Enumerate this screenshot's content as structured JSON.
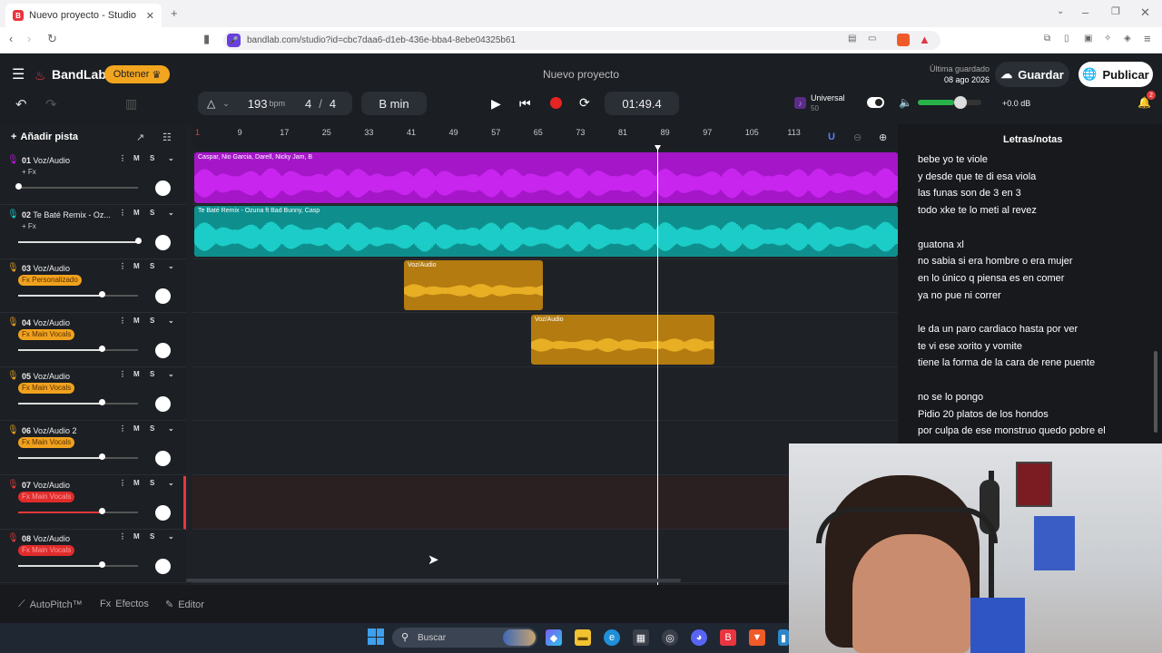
{
  "browser": {
    "tab_title": "Nuevo proyecto - Studio",
    "url": "bandlab.com/studio?id=cbc7daa6-d1eb-436e-bba4-8ebe04325b61"
  },
  "header": {
    "brand": "BandLab",
    "get_button": "Obtener",
    "project_title": "Nuevo proyecto",
    "last_saved_label": "Última guardado",
    "last_saved_date": "08 ago 2026",
    "save_button": "Guardar",
    "publish_button": "Publicar",
    "notification_count": "2"
  },
  "transport": {
    "tempo": "193",
    "tempo_unit": "bpm",
    "time_sig_num": "4",
    "time_sig_den": "4",
    "key": "B min",
    "time": "01:49.4",
    "preset_name": "Universal",
    "preset_sub": "50",
    "master_db": "+0.0 dB"
  },
  "tracks_panel": {
    "add_track": "Añadir pista"
  },
  "tracks": [
    {
      "num": "01",
      "name": "Voz/Audio",
      "fx": "+ Fx",
      "fx_style": "plain",
      "color": "#c216e6",
      "vol": 0.0
    },
    {
      "num": "02",
      "name": "Te Baté Remix - Oz...",
      "fx": "+ Fx",
      "fx_style": "plain",
      "color": "#19c9c5",
      "vol": 1.0
    },
    {
      "num": "03",
      "name": "Voz/Audio",
      "fx": "Fx Personalizado",
      "fx_style": "orange",
      "color": "#e7a21c",
      "vol": 0.7
    },
    {
      "num": "04",
      "name": "Voz/Audio",
      "fx": "Fx Main Vocals",
      "fx_style": "orange",
      "color": "#e7a21c",
      "vol": 0.7
    },
    {
      "num": "05",
      "name": "Voz/Audio",
      "fx": "Fx Main Vocals",
      "fx_style": "orange",
      "color": "#e7a21c",
      "vol": 0.7
    },
    {
      "num": "06",
      "name": "Voz/Audio 2",
      "fx": "Fx Main Vocals",
      "fx_style": "orange",
      "color": "#e7a21c",
      "vol": 0.7
    },
    {
      "num": "07",
      "name": "Voz/Audio",
      "fx": "Fx Main Vocals",
      "fx_style": "red",
      "color": "#e23a3a",
      "vol": 0.7
    },
    {
      "num": "08",
      "name": "Voz/Audio",
      "fx": "Fx Main Vocals",
      "fx_style": "red",
      "color": "#e23a3a",
      "vol": 0.7
    }
  ],
  "ruler_ticks": [
    "1",
    "9",
    "17",
    "25",
    "33",
    "41",
    "49",
    "57",
    "65",
    "73",
    "81",
    "89",
    "97",
    "105",
    "113"
  ],
  "clips": [
    {
      "lane": 0,
      "label": "Caspar, Nio Garcia, Darell, Nicky Jam, B"
    },
    {
      "lane": 1,
      "label": "Te Baté Remix - Ozuna ft Bad Bunny, Casp"
    },
    {
      "lane": 2,
      "label": "Voz/Audio"
    },
    {
      "lane": 3,
      "label": "Voz/Audio"
    }
  ],
  "lyrics": {
    "title": "Letras/notas",
    "lines": [
      "bebe yo te viole",
      "y desde que te di esa viola",
      "las funas son de 3 en 3",
      "todo xke te lo meti al revez",
      "",
      "guatona xl",
      "no sabia si era hombre o era mujer",
      "en lo único q piensa es en comer",
      "ya no pue ni correr",
      "",
      "le da un paro cardiaco hasta por ver",
      "te vi ese xorito y vomite",
      "tiene la forma de la cara de rene puente",
      "",
      "no se lo pongo",
      "Pidio 20 platos de los hondos",
      "por culpa de ese monstruo quedo pobre el"
    ]
  },
  "bottom": {
    "autopitch": "AutoPitch™",
    "effects": "Efectos",
    "editor": "Editor"
  },
  "taskbar": {
    "search_placeholder": "Buscar"
  }
}
